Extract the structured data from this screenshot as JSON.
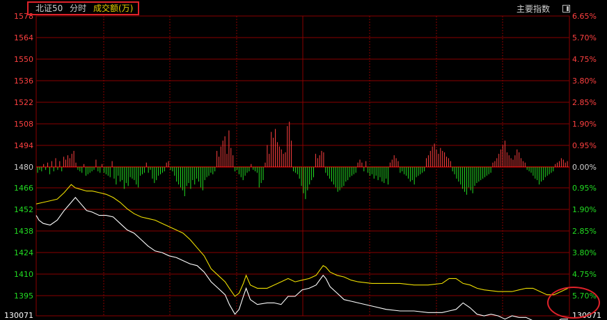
{
  "header": {
    "index_name": "北证50",
    "period": "分时",
    "volume_label": "成交额(万)"
  },
  "toolbar": {
    "main_index_label": "主要指数",
    "toggle_icon": "panel-toggle-icon"
  },
  "colors": {
    "background": "#000000",
    "grid": "#8a0000",
    "up": "#ff4040",
    "down": "#22dd22",
    "price_line": "#ffffff",
    "avg_line": "#f0e000",
    "highlight": "#e0222a"
  },
  "chart_data": {
    "type": "line",
    "y_left_ticks": [
      "1578",
      "1564",
      "1550",
      "1536",
      "1522",
      "1508",
      "1494",
      "1480",
      "1466",
      "1452",
      "1438",
      "1424",
      "1410",
      "1395",
      "130071"
    ],
    "y_right_ticks": [
      "6.65%",
      "5.70%",
      "4.75%",
      "3.80%",
      "2.85%",
      "1.90%",
      "0.95%",
      "0.00%",
      "0.95%",
      "1.90%",
      "2.85%",
      "3.80%",
      "4.75%",
      "5.70%",
      "130071"
    ],
    "ylim": [
      1393,
      1578
    ],
    "prev_close": 1480,
    "grid": true,
    "series": [
      {
        "name": "",
        "role": "price",
        "points": [
          [
            0,
            1455
          ],
          [
            2,
            1452
          ],
          [
            5,
            1450
          ],
          [
            10,
            1449
          ],
          [
            15,
            1452
          ],
          [
            20,
            1458
          ],
          [
            25,
            1463
          ],
          [
            28,
            1466
          ],
          [
            32,
            1462
          ],
          [
            36,
            1458
          ],
          [
            40,
            1457
          ],
          [
            45,
            1455
          ],
          [
            50,
            1455
          ],
          [
            55,
            1454
          ],
          [
            60,
            1450
          ],
          [
            65,
            1446
          ],
          [
            70,
            1444
          ],
          [
            75,
            1440
          ],
          [
            80,
            1436
          ],
          [
            85,
            1433
          ],
          [
            90,
            1432
          ],
          [
            95,
            1430
          ],
          [
            100,
            1429
          ],
          [
            105,
            1427
          ],
          [
            110,
            1425
          ],
          [
            115,
            1424
          ],
          [
            120,
            1420
          ],
          [
            125,
            1414
          ],
          [
            130,
            1410
          ],
          [
            135,
            1406
          ],
          [
            138,
            1400
          ],
          [
            142,
            1394
          ],
          [
            145,
            1397
          ],
          [
            148,
            1405
          ],
          [
            150,
            1410
          ],
          [
            153,
            1403
          ],
          [
            158,
            1400
          ],
          [
            165,
            1401
          ],
          [
            170,
            1401
          ],
          [
            175,
            1400
          ],
          [
            180,
            1405
          ],
          [
            185,
            1405
          ],
          [
            190,
            1409
          ],
          [
            195,
            1410
          ],
          [
            200,
            1412
          ],
          [
            205,
            1418
          ],
          [
            207,
            1416
          ],
          [
            210,
            1411
          ],
          [
            215,
            1407
          ],
          [
            220,
            1403
          ],
          [
            225,
            1402
          ],
          [
            230,
            1401
          ],
          [
            240,
            1399
          ],
          [
            250,
            1397
          ],
          [
            260,
            1396
          ],
          [
            270,
            1396
          ],
          [
            280,
            1395
          ],
          [
            290,
            1395
          ],
          [
            295,
            1396
          ],
          [
            300,
            1397
          ],
          [
            305,
            1401
          ],
          [
            310,
            1398
          ],
          [
            315,
            1394
          ],
          [
            320,
            1393
          ],
          [
            325,
            1394
          ],
          [
            330,
            1393
          ],
          [
            335,
            1391
          ],
          [
            340,
            1393
          ],
          [
            345,
            1392
          ],
          [
            350,
            1392
          ],
          [
            355,
            1390
          ],
          [
            360,
            1388
          ],
          [
            365,
            1387
          ],
          [
            370,
            1388
          ],
          [
            375,
            1391
          ],
          [
            380,
            1391
          ]
        ]
      },
      {
        "name": "",
        "role": "average",
        "points": [
          [
            0,
            1462
          ],
          [
            5,
            1463
          ],
          [
            10,
            1464
          ],
          [
            15,
            1465
          ],
          [
            20,
            1469
          ],
          [
            25,
            1474
          ],
          [
            28,
            1472
          ],
          [
            32,
            1471
          ],
          [
            36,
            1470
          ],
          [
            40,
            1470
          ],
          [
            45,
            1469
          ],
          [
            50,
            1468
          ],
          [
            55,
            1466
          ],
          [
            60,
            1463
          ],
          [
            65,
            1459
          ],
          [
            70,
            1456
          ],
          [
            75,
            1454
          ],
          [
            80,
            1453
          ],
          [
            85,
            1452
          ],
          [
            90,
            1450
          ],
          [
            95,
            1448
          ],
          [
            100,
            1446
          ],
          [
            105,
            1444
          ],
          [
            110,
            1440
          ],
          [
            115,
            1435
          ],
          [
            120,
            1430
          ],
          [
            125,
            1422
          ],
          [
            130,
            1418
          ],
          [
            135,
            1414
          ],
          [
            138,
            1410
          ],
          [
            142,
            1405
          ],
          [
            145,
            1407
          ],
          [
            148,
            1413
          ],
          [
            150,
            1418
          ],
          [
            153,
            1412
          ],
          [
            158,
            1410
          ],
          [
            165,
            1410
          ],
          [
            170,
            1412
          ],
          [
            175,
            1414
          ],
          [
            180,
            1416
          ],
          [
            185,
            1414
          ],
          [
            190,
            1415
          ],
          [
            195,
            1416
          ],
          [
            200,
            1418
          ],
          [
            205,
            1424
          ],
          [
            207,
            1423
          ],
          [
            210,
            1420
          ],
          [
            215,
            1418
          ],
          [
            220,
            1417
          ],
          [
            225,
            1415
          ],
          [
            230,
            1414
          ],
          [
            240,
            1413
          ],
          [
            250,
            1413
          ],
          [
            260,
            1413
          ],
          [
            270,
            1412
          ],
          [
            280,
            1412
          ],
          [
            290,
            1413
          ],
          [
            295,
            1416
          ],
          [
            300,
            1416
          ],
          [
            305,
            1413
          ],
          [
            310,
            1412
          ],
          [
            315,
            1410
          ],
          [
            320,
            1409
          ],
          [
            330,
            1408
          ],
          [
            340,
            1408
          ],
          [
            345,
            1409
          ],
          [
            350,
            1410
          ],
          [
            355,
            1410
          ],
          [
            360,
            1408
          ],
          [
            365,
            1406
          ],
          [
            370,
            1406
          ],
          [
            375,
            1408
          ],
          [
            380,
            1410
          ]
        ]
      }
    ],
    "volume_bars": [
      -4,
      -2,
      -3,
      2,
      -2,
      3,
      -5,
      4,
      -3,
      6,
      -2,
      4,
      -3,
      7,
      5,
      8,
      6,
      9,
      11,
      3,
      -2,
      -3,
      -4,
      2,
      -6,
      -5,
      -4,
      -3,
      -2,
      5,
      -3,
      -4,
      2,
      -4,
      -5,
      -6,
      -7,
      4,
      -8,
      -12,
      -6,
      -10,
      -9,
      -15,
      -11,
      -13,
      -7,
      -8,
      -9,
      -12,
      -14,
      -6,
      -5,
      -4,
      3,
      -4,
      -2,
      -8,
      -11,
      -9,
      -6,
      -5,
      -4,
      -3,
      3,
      4,
      -2,
      -3,
      -6,
      -10,
      -12,
      -14,
      -16,
      -20,
      -13,
      -11,
      -15,
      -9,
      -12,
      -8,
      -10,
      -14,
      -16,
      -9,
      -7,
      -6,
      -4,
      -5,
      -3,
      11,
      7,
      14,
      18,
      21,
      9,
      25,
      13,
      8,
      -3,
      -2,
      -5,
      -7,
      -9,
      -6,
      -4,
      -3,
      2,
      -2,
      -3,
      -4,
      -14,
      -11,
      -9,
      3,
      15,
      9,
      24,
      20,
      26,
      17,
      14,
      12,
      9,
      10,
      28,
      31,
      18,
      -3,
      -4,
      -5,
      -8,
      -13,
      -18,
      -22,
      -16,
      -12,
      -9,
      -7,
      9,
      6,
      8,
      11,
      10,
      -4,
      -6,
      -8,
      -10,
      -12,
      -14,
      -17,
      -16,
      -14,
      -13,
      -10,
      -9,
      -7,
      -6,
      -5,
      -4,
      3,
      5,
      3,
      -3,
      4,
      -4,
      -6,
      -5,
      -8,
      -6,
      -9,
      -7,
      -10,
      -11,
      -8,
      -12,
      3,
      5,
      8,
      6,
      4,
      -4,
      -3,
      -5,
      -6,
      -8,
      -10,
      -9,
      -12,
      -7,
      -6,
      -5,
      -4,
      -3,
      6,
      8,
      11,
      14,
      16,
      12,
      9,
      13,
      11,
      10,
      7,
      6,
      4,
      -3,
      -5,
      -8,
      -10,
      -12,
      -15,
      -17,
      -19,
      -14,
      -16,
      -18,
      -13,
      -11,
      -10,
      -9,
      -8,
      -7,
      -6,
      -5,
      -4,
      3,
      4,
      6,
      9,
      12,
      15,
      18,
      10,
      8,
      6,
      5,
      8,
      12,
      10,
      6,
      4,
      3,
      -2,
      -3,
      -4,
      -6,
      -8,
      -9,
      -12,
      -10,
      -9,
      -7,
      -6,
      -5,
      -4,
      -3,
      2,
      3,
      4,
      6,
      5,
      3,
      4
    ]
  }
}
